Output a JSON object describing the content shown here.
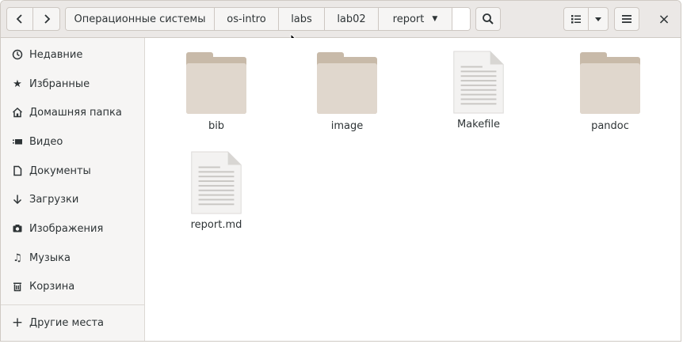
{
  "headerbar": {
    "back_icon": "chevron-left-icon",
    "forward_icon": "chevron-right-icon",
    "breadcrumbs": [
      {
        "label": "Операционные системы"
      },
      {
        "label": "os-intro"
      },
      {
        "label": "labs"
      },
      {
        "label": "lab02"
      },
      {
        "label": "report",
        "current": true
      }
    ],
    "search_icon": "search-icon",
    "view_icon": "list-view-icon",
    "view_menu_icon": "chevron-down-icon",
    "menu_icon": "hamburger-menu-icon",
    "close_label": "×"
  },
  "sidebar": {
    "items": [
      {
        "label": "Недавние",
        "icon": "recent-icon",
        "glyph": "⏲"
      },
      {
        "label": "Избранные",
        "icon": "star-icon",
        "glyph": "★"
      },
      {
        "label": "Домашняя папка",
        "icon": "home-icon",
        "glyph": "⌂"
      },
      {
        "label": "Видео",
        "icon": "video-icon",
        "glyph": "▬"
      },
      {
        "label": "Документы",
        "icon": "document-icon",
        "glyph": "▯"
      },
      {
        "label": "Загрузки",
        "icon": "download-icon",
        "glyph": "↓"
      },
      {
        "label": "Изображения",
        "icon": "camera-icon",
        "glyph": "◙"
      },
      {
        "label": "Музыка",
        "icon": "music-icon",
        "glyph": "♫"
      },
      {
        "label": "Корзина",
        "icon": "trash-icon",
        "glyph": "▥"
      }
    ],
    "other_places": {
      "label": "Другие места",
      "icon": "plus-icon",
      "glyph": "+"
    }
  },
  "files": [
    {
      "name": "bib",
      "type": "folder"
    },
    {
      "name": "image",
      "type": "folder"
    },
    {
      "name": "Makefile",
      "type": "document"
    },
    {
      "name": "pandoc",
      "type": "folder"
    },
    {
      "name": "report.md",
      "type": "document"
    }
  ],
  "colors": {
    "headerbar": "#ebe8e6",
    "sidebar": "#f6f5f4",
    "folder_front": "#e0d7cd",
    "folder_back": "#c8baa9",
    "text": "#2e3436"
  }
}
